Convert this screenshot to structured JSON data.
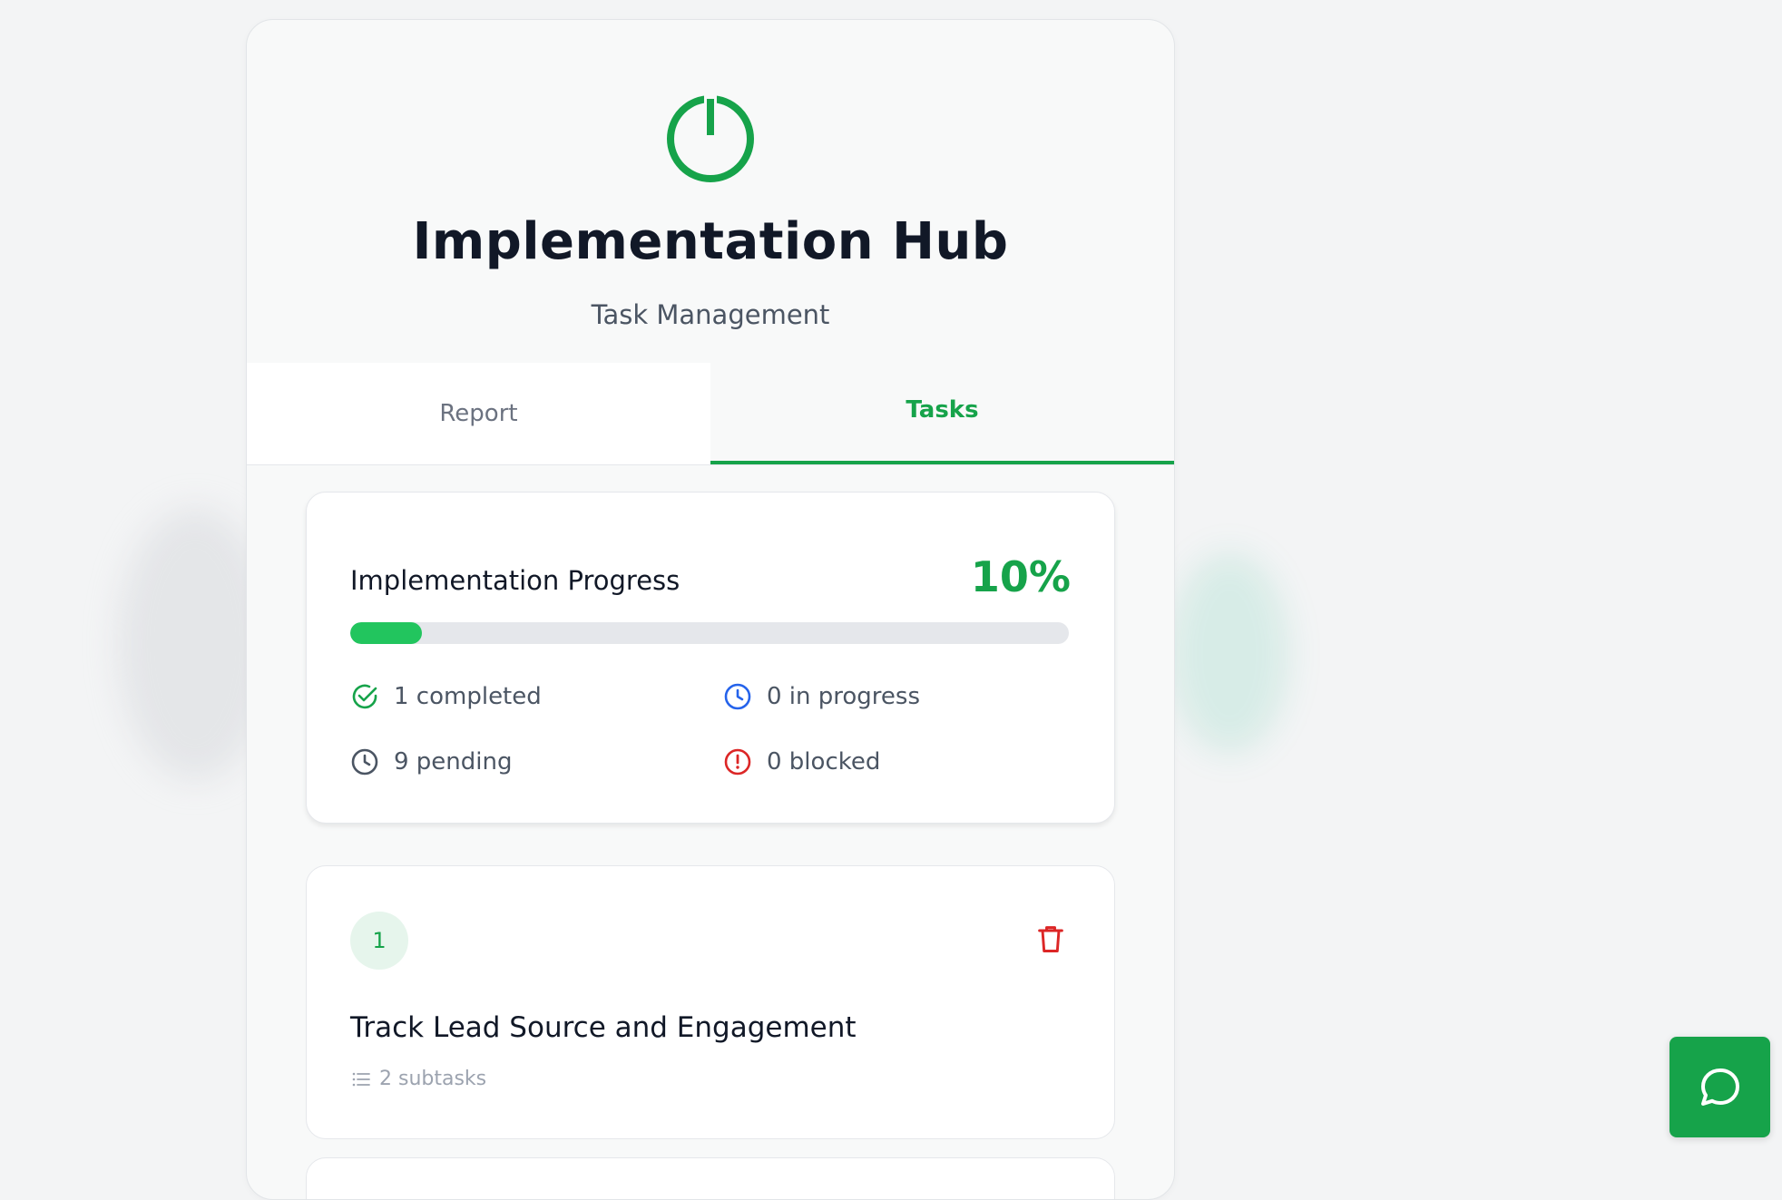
{
  "header": {
    "icon": "power-icon",
    "title": "Implementation Hub",
    "subtitle": "Task Management"
  },
  "tabs": [
    {
      "label": "Report",
      "active": false
    },
    {
      "label": "Tasks",
      "active": true
    }
  ],
  "progress": {
    "title": "Implementation Progress",
    "percent_label": "10%",
    "percent_value": 10,
    "stats": {
      "completed": "1 completed",
      "in_progress": "0 in progress",
      "pending": "9 pending",
      "blocked": "0 blocked"
    }
  },
  "tasks": [
    {
      "number": "1",
      "title": "Track Lead Source and Engagement",
      "subtasks": "2 subtasks"
    }
  ],
  "chat": {
    "icon": "chat-bubble-icon"
  },
  "colors": {
    "accent": "#16a34a",
    "progress_fill": "#22c55e",
    "in_progress": "#2563eb",
    "blocked": "#dc2626",
    "pending": "#4b5563"
  }
}
